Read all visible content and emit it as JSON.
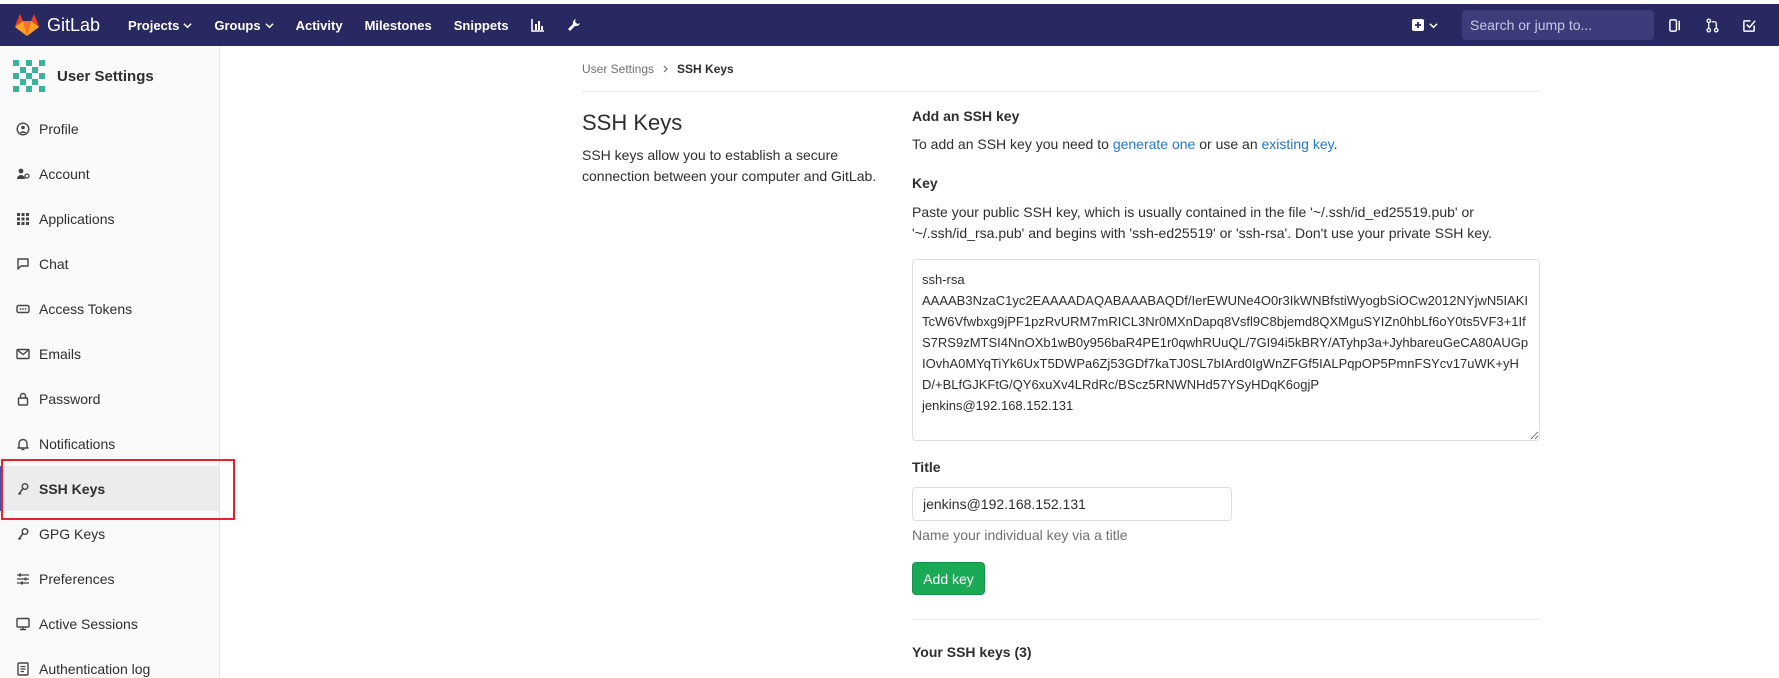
{
  "navbar": {
    "brand": "GitLab",
    "items": [
      {
        "label": "Projects",
        "dropdown": true
      },
      {
        "label": "Groups",
        "dropdown": true
      },
      {
        "label": "Activity"
      },
      {
        "label": "Milestones"
      },
      {
        "label": "Snippets"
      }
    ],
    "search_placeholder": "Search or jump to...",
    "colors": {
      "background": "#292961",
      "search_bg": "#3c3c7a",
      "logo": "#e24329"
    }
  },
  "sidebar": {
    "title": "User Settings",
    "items": [
      {
        "label": "Profile",
        "icon": "profile-icon"
      },
      {
        "label": "Account",
        "icon": "account-icon"
      },
      {
        "label": "Applications",
        "icon": "applications-icon"
      },
      {
        "label": "Chat",
        "icon": "chat-icon"
      },
      {
        "label": "Access Tokens",
        "icon": "token-icon"
      },
      {
        "label": "Emails",
        "icon": "email-icon"
      },
      {
        "label": "Password",
        "icon": "lock-icon"
      },
      {
        "label": "Notifications",
        "icon": "bell-icon"
      },
      {
        "label": "SSH Keys",
        "icon": "key-icon",
        "active": true
      },
      {
        "label": "GPG Keys",
        "icon": "key-icon"
      },
      {
        "label": "Preferences",
        "icon": "preferences-icon"
      },
      {
        "label": "Active Sessions",
        "icon": "monitor-icon"
      },
      {
        "label": "Authentication log",
        "icon": "log-icon"
      }
    ],
    "highlight_color": "#e8222b"
  },
  "breadcrumb": {
    "parent": "User Settings",
    "current": "SSH Keys"
  },
  "page": {
    "title": "SSH Keys",
    "description": "SSH keys allow you to establish a secure connection between your computer and GitLab."
  },
  "form": {
    "add_heading": "Add an SSH key",
    "intro_prefix": "To add an SSH key you need to ",
    "generate_link": "generate one",
    "intro_middle": " or use an ",
    "existing_link": "existing key",
    "intro_suffix": ".",
    "key_label": "Key",
    "key_help": "Paste your public SSH key, which is usually contained in the file '~/.ssh/id_ed25519.pub' or '~/.ssh/id_rsa.pub' and begins with 'ssh-ed25519' or 'ssh-rsa'. Don't use your private SSH key.",
    "key_value": "ssh-rsa\nAAAAB3NzaC1yc2EAAAADAQABAAABAQDf/IerEWUNe4O0r3IkWNBfstiWyogbSiOCw2012NYjwN5IAKITcW6Vfwbxg9jPF1pzRvURM7mRICL3Nr0MXnDapq8Vsfl9C8bjemd8QXMguSYIZn0hbLf6oY0ts5VF3+1IfS7RS9zMTSI4NnOXb1wB0y956baR4PE1r0qwhRUuQL/7GI94i5kBRY/ATyhp3a+JyhbareuGeCA80AUGpIOvhA0MYqTiYk6UxT5DWPa6Zj53GDf7kaTJ0SL7bIArd0IgWnZFGf5IALPqpOP5PmnFSYcv17uWK+yHD/+BLfGJKFtG/QY6xuXv4LRdRc/BScz5RNWNHd57YSyHDqK6ogjP\njenkins@192.168.152.131",
    "title_label": "Title",
    "title_value": "jenkins@192.168.152.131",
    "title_help": "Name your individual key via a title",
    "add_button": "Add key",
    "your_keys": "Your SSH keys (3)",
    "button_color": "#1aaa55"
  }
}
